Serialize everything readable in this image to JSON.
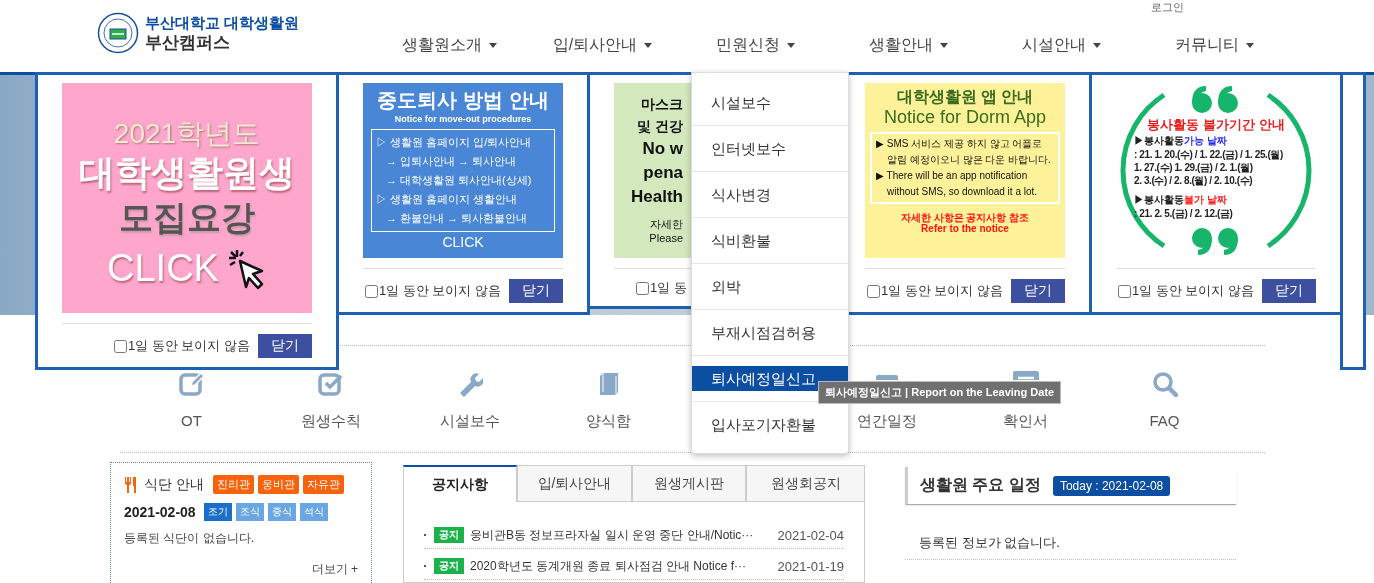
{
  "header": {
    "logo": {
      "title": "부산대학교 대학생활원",
      "subtitle": "부산캠퍼스"
    },
    "login": "로그인",
    "nav": [
      {
        "label": "생활원소개"
      },
      {
        "label": "입/퇴사안내"
      },
      {
        "label": "민원신청"
      },
      {
        "label": "생활안내"
      },
      {
        "label": "시설안내"
      },
      {
        "label": "커뮤니티"
      }
    ]
  },
  "popups": [
    {
      "kind": "recruit",
      "lines": [
        "2021학년도",
        "대학생활원생",
        "모집요강"
      ],
      "cta": "CLICK",
      "footer": {
        "checkbox_label": "1일 동안 보이지 않음",
        "checked": false,
        "close": "닫기"
      }
    },
    {
      "kind": "steps",
      "title": "중도퇴사 방법 안내",
      "subtitle": "Notice for move-out procedures",
      "steps": [
        "▷ 생활원 홈페이지 입/퇴사안내",
        "→ 입퇴사안내 → 퇴사안내",
        "→ 대학생활원 퇴사안내(상세)",
        "▷ 생활원 홈페이지 생활안내",
        "→ 환불안내 → 퇴사환불안내"
      ],
      "cta": "CLICK",
      "footer": {
        "checkbox_label": "1일 동안 보이지 않음",
        "checked": false,
        "close": "닫기"
      }
    },
    {
      "kind": "clipped",
      "lines": [
        "마스크",
        "및 건강",
        "No w",
        "pena",
        "Health",
        "자세한",
        "Please"
      ],
      "footer": {
        "checkbox_label": "1일 동",
        "checked": false
      }
    },
    {
      "kind": "app",
      "title": "대학생활원 앱 안내",
      "subtitle": "Notice for Dorm App",
      "bullets": [
        "▶ SMS 서비스 제공 하지 않고 어플로 알림 예정이오니 많은 다운 바랍니다.",
        "▶ There will be an app notification without SMS, so download it a lot."
      ],
      "notes": [
        "자세한 사항은 공지사항 참조",
        "Refer to the notice"
      ],
      "footer": {
        "checkbox_label": "1일 동안 보이지 않음",
        "checked": false,
        "close": "닫기"
      }
    },
    {
      "kind": "quote",
      "title": "봉사활동 불가기간 안내",
      "sections": [
        {
          "label": "▶봉사활동",
          "highlight": "가능 날짜",
          "color": "#2b2bf0",
          "dates": [
            ": 21. 1. 20.(수) / 1. 22.(금) / 1. 25.(월)",
            "1. 27.(수) 1. 29.(금) / 2. 1.(월)",
            "2. 3.(수) / 2. 8.(월) / 2. 10.(수)"
          ]
        },
        {
          "label": "▶봉사활동",
          "highlight": "불가 날짜",
          "color": "#ff1a1a",
          "dates": [
            ": 21. 2. 5.(금) / 2. 12.(금)"
          ]
        }
      ],
      "footer": {
        "checkbox_label": "1일 동안 보이지 않음",
        "checked": false,
        "close": "닫기"
      }
    },
    {
      "kind": "empty"
    }
  ],
  "open_menu": {
    "items": [
      {
        "label": "시설보수",
        "selected": false
      },
      {
        "label": "인터넷보수",
        "selected": false
      },
      {
        "label": "식사변경",
        "selected": false
      },
      {
        "label": "식비환불",
        "selected": false
      },
      {
        "label": "외박",
        "selected": false
      },
      {
        "label": "부재시점검허용",
        "selected": false
      },
      {
        "label": "퇴사예정일신고",
        "selected": true
      },
      {
        "label": "입사포기자환불",
        "selected": false
      }
    ]
  },
  "tooltip": "퇴사예정일신고 | Report on the Leaving Date",
  "quick_links": [
    {
      "label": "OT"
    },
    {
      "label": "원생수칙"
    },
    {
      "label": "시설보수"
    },
    {
      "label": "양식함"
    },
    {
      "label": "연간일정"
    },
    {
      "label": "확인서"
    },
    {
      "label": "FAQ"
    }
  ],
  "meal": {
    "title": "식단 안내",
    "halls": [
      {
        "label": "진리관"
      },
      {
        "label": "웅비관"
      },
      {
        "label": "자유관"
      }
    ],
    "date": "2021-02-08",
    "meals": [
      {
        "label": "조기",
        "selected": true
      },
      {
        "label": "조식",
        "selected": false
      },
      {
        "label": "중식",
        "selected": false
      },
      {
        "label": "석식",
        "selected": false
      }
    ],
    "empty_message": "등록된 식단이 없습니다.",
    "more": "더보기 +"
  },
  "notices": {
    "tabs": [
      {
        "label": "공지사항",
        "selected": true
      },
      {
        "label": "입/퇴사안내",
        "selected": false
      },
      {
        "label": "원생게시판",
        "selected": false
      },
      {
        "label": "원생회공지",
        "selected": false
      }
    ],
    "rows": [
      {
        "badge": "공지",
        "title": "웅비관B동 정보프라자실 일시 운영 중단 안내/Notic···",
        "date": "2021-02-04"
      },
      {
        "badge": "공지",
        "title": "2020학년도 동계개원 종료 퇴사점검 안내 Notice f···",
        "date": "2021-01-19"
      }
    ]
  },
  "schedule": {
    "title": "생활원 주요 일정",
    "today": "Today : 2021-02-08",
    "empty_message": "등록된 정보가 없습니다."
  }
}
